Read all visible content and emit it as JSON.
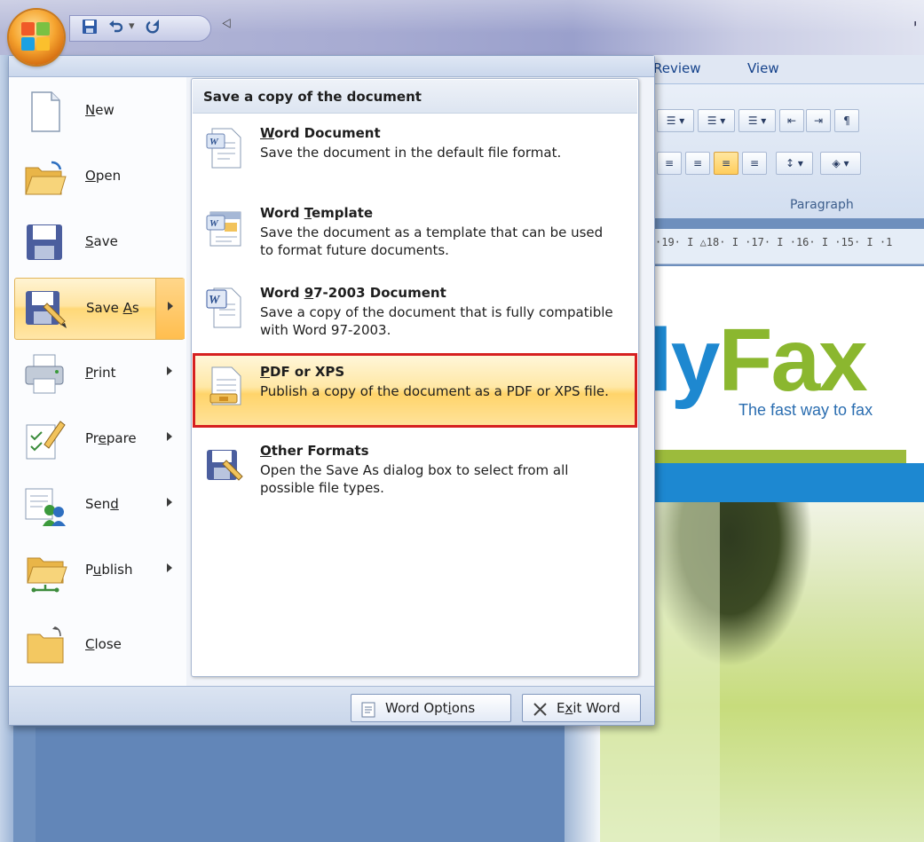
{
  "window": {
    "title_fragment": "י",
    "qat_customize_glyph": "⨞"
  },
  "ribbon": {
    "tabs": [
      "Review",
      "View"
    ],
    "group_label": "Paragraph",
    "ruler_text": "·19· I △18· I ·17· I ·16· I ·15· I ·1"
  },
  "document": {
    "logo_left": "ly",
    "logo_right": "Fax",
    "tagline": "The fast way to fax"
  },
  "menu": {
    "items": [
      {
        "pre": "",
        "key": "N",
        "post": "ew",
        "icon": "new-document-icon",
        "has_arrow": false
      },
      {
        "pre": "",
        "key": "O",
        "post": "pen",
        "icon": "open-folder-icon",
        "has_arrow": false
      },
      {
        "pre": "",
        "key": "S",
        "post": "ave",
        "icon": "save-disk-icon",
        "has_arrow": false
      },
      {
        "pre": "Save ",
        "key": "A",
        "post": "s",
        "icon": "save-as-icon",
        "has_arrow": true
      },
      {
        "pre": "",
        "key": "P",
        "post": "rint",
        "icon": "printer-icon",
        "has_arrow": true
      },
      {
        "pre": "Pr",
        "key": "e",
        "post": "pare",
        "icon": "prepare-pen-icon",
        "has_arrow": true
      },
      {
        "pre": "Sen",
        "key": "d",
        "post": "",
        "icon": "send-users-icon",
        "has_arrow": true
      },
      {
        "pre": "P",
        "key": "u",
        "post": "blish",
        "icon": "publish-folder-icon",
        "has_arrow": true
      },
      {
        "pre": "",
        "key": "C",
        "post": "lose",
        "icon": "close-folder-icon",
        "has_arrow": false
      }
    ],
    "active_item": "Save As",
    "submenu": {
      "header": "Save a copy of the document",
      "items": [
        {
          "pre": "",
          "key": "W",
          "post": "ord Document",
          "desc": "Save the document in the default file format.",
          "icon": "word-document-icon"
        },
        {
          "pre": "Word ",
          "key": "T",
          "post": "emplate",
          "desc": "Save the document as a template that can be used to format future documents.",
          "icon": "word-template-icon"
        },
        {
          "pre": "Word ",
          "key": "9",
          "post": "7-2003 Document",
          "desc": "Save a copy of the document that is fully compatible with Word 97-2003.",
          "icon": "word-97-document-icon"
        },
        {
          "pre": "",
          "key": "P",
          "post": "DF or XPS",
          "desc": "Publish a copy of the document as a PDF or XPS file.",
          "icon": "pdf-xps-icon"
        },
        {
          "pre": "",
          "key": "O",
          "post": "ther Formats",
          "desc": "Open the Save As dialog box to select from all possible file types.",
          "icon": "other-formats-icon"
        }
      ],
      "selected_item": "PDF or XPS"
    },
    "footer": {
      "options": {
        "pre": "Word Opt",
        "key": "i",
        "post": "ons"
      },
      "exit": {
        "pre": "E",
        "key": "x",
        "post": "it Word"
      }
    }
  }
}
